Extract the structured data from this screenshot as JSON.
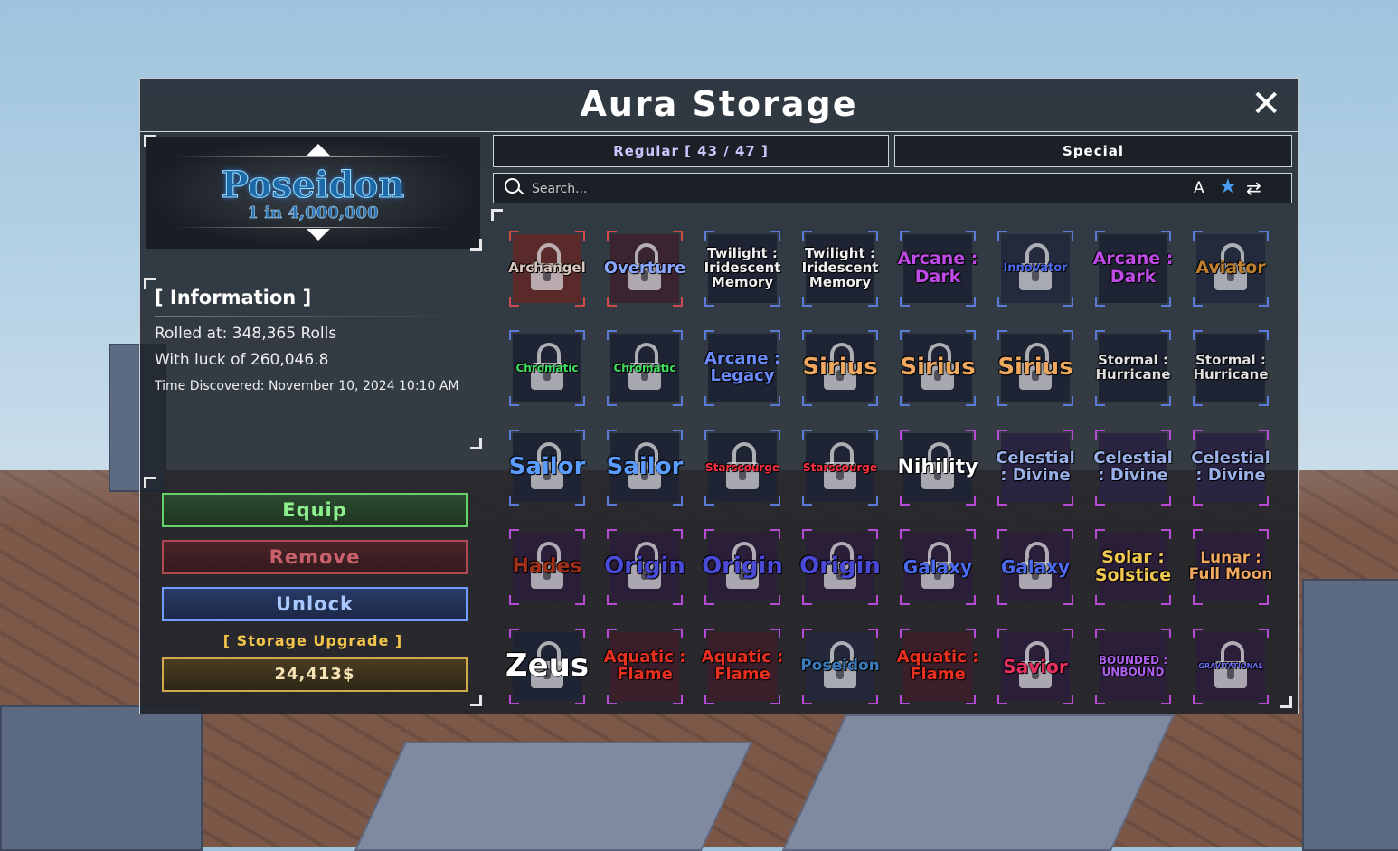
{
  "window": {
    "title": "Aura Storage",
    "close_label": "✕"
  },
  "featured": {
    "name": "Poseidon",
    "rarity": "1 in 4,000,000"
  },
  "information": {
    "header": "[ Information ]",
    "rolled_at": "Rolled at: 348,365 Rolls",
    "luck": "With luck of 260,046.8",
    "time_discovered": "Time Discovered: November 10, 2024 10:10 AM"
  },
  "actions": {
    "equip": "Equip",
    "remove": "Remove",
    "unlock": "Unlock",
    "storage_upgrade": "[ Storage Upgrade ]",
    "price": "24,413$"
  },
  "tabs": {
    "regular": "Regular [ 43 / 47 ]",
    "special": "Special"
  },
  "search": {
    "placeholder": "Search..."
  },
  "toolbar_icons": [
    "sort-alpha-icon",
    "favorite-star-icon",
    "swap-icon"
  ],
  "colors": {
    "purple_frame": "#b84ad8",
    "blue_frame": "#5a7bd8",
    "red_frame": "#d04a4a",
    "star": "#4a9cf0"
  },
  "auras": [
    {
      "name": "Archangel",
      "locked": true,
      "color": "#d8c8c0",
      "size": 15,
      "frame": "#d04a4a",
      "bg": "#5a2a2a"
    },
    {
      "name": "Overture",
      "locked": true,
      "color": "#8aa8ff",
      "size": 18,
      "frame": "#d04a4a",
      "bg": "#3a2430"
    },
    {
      "name": "Twilight : Iridescent Memory",
      "locked": false,
      "color": "#f0f0f0",
      "size": 15,
      "frame": "#5a7bd8",
      "bg": "#1e2433"
    },
    {
      "name": "Twilight : Iridescent Memory",
      "locked": false,
      "color": "#f0f0f0",
      "size": 15,
      "frame": "#5a7bd8",
      "bg": "#1e2433"
    },
    {
      "name": "Arcane : Dark",
      "locked": false,
      "color": "#c04ae8",
      "size": 19,
      "frame": "#5a7bd8",
      "bg": "#1e2433"
    },
    {
      "name": "Innovator",
      "locked": true,
      "color": "#4a6af0",
      "size": 13,
      "frame": "#5a7bd8",
      "bg": "#232a3c"
    },
    {
      "name": "Arcane : Dark",
      "locked": false,
      "color": "#c04ae8",
      "size": 19,
      "frame": "#5a7bd8",
      "bg": "#1e2433"
    },
    {
      "name": "Aviator",
      "locked": true,
      "color": "#c08030",
      "size": 19,
      "frame": "#5a7bd8",
      "bg": "#232a3c"
    },
    {
      "name": "Chromatic",
      "locked": true,
      "color": "#40e060",
      "size": 12,
      "frame": "#5a7bd8",
      "bg": "#1e2433"
    },
    {
      "name": "Chromatic",
      "locked": true,
      "color": "#40e060",
      "size": 12,
      "frame": "#5a7bd8",
      "bg": "#1e2433"
    },
    {
      "name": "Arcane : Legacy",
      "locked": false,
      "color": "#6a8cff",
      "size": 18,
      "frame": "#5a7bd8",
      "bg": "#1e2433"
    },
    {
      "name": "Sirius",
      "locked": true,
      "color": "#f0a860",
      "size": 26,
      "frame": "#5a7bd8",
      "bg": "#1e2433"
    },
    {
      "name": "Sirius",
      "locked": true,
      "color": "#f0a860",
      "size": 26,
      "frame": "#5a7bd8",
      "bg": "#1e2433"
    },
    {
      "name": "Sirius",
      "locked": true,
      "color": "#f0a860",
      "size": 26,
      "frame": "#5a7bd8",
      "bg": "#1e2433"
    },
    {
      "name": "Stormal : Hurricane",
      "locked": false,
      "color": "#e0e0e0",
      "size": 15,
      "frame": "#5a7bd8",
      "bg": "#1e2433"
    },
    {
      "name": "Stormal : Hurricane",
      "locked": false,
      "color": "#e0e0e0",
      "size": 15,
      "frame": "#5a7bd8",
      "bg": "#1e2433"
    },
    {
      "name": "Sailor",
      "locked": true,
      "color": "#5a9cff",
      "size": 26,
      "frame": "#5a7bd8",
      "bg": "#1e2433"
    },
    {
      "name": "Sailor",
      "locked": true,
      "color": "#5a9cff",
      "size": 26,
      "frame": "#5a7bd8",
      "bg": "#1e2433"
    },
    {
      "name": "Starscourge",
      "locked": true,
      "color": "#ff3040",
      "size": 12,
      "frame": "#5a7bd8",
      "bg": "#1e2433"
    },
    {
      "name": "Starscourge",
      "locked": true,
      "color": "#ff3040",
      "size": 12,
      "frame": "#5a7bd8",
      "bg": "#1e2433"
    },
    {
      "name": "Nihility",
      "locked": true,
      "color": "#ffffff",
      "size": 22,
      "frame": "#b84ad8",
      "bg": "#1e2433"
    },
    {
      "name": "Celestial : Divine",
      "locked": false,
      "color": "#9ab0e8",
      "size": 18,
      "frame": "#b84ad8",
      "bg": "#2a2440"
    },
    {
      "name": "Celestial : Divine",
      "locked": false,
      "color": "#9ab0e8",
      "size": 18,
      "frame": "#b84ad8",
      "bg": "#2a2440"
    },
    {
      "name": "Celestial : Divine",
      "locked": false,
      "color": "#9ab0e8",
      "size": 18,
      "frame": "#b84ad8",
      "bg": "#2a2440"
    },
    {
      "name": "Hades",
      "locked": true,
      "color": "#a03018",
      "size": 22,
      "frame": "#b84ad8",
      "bg": "#2a1e38"
    },
    {
      "name": "Origin",
      "locked": true,
      "color": "#4a4ad8",
      "size": 26,
      "frame": "#b84ad8",
      "bg": "#2a1e38"
    },
    {
      "name": "Origin",
      "locked": true,
      "color": "#4a4ad8",
      "size": 26,
      "frame": "#b84ad8",
      "bg": "#2a1e38"
    },
    {
      "name": "Origin",
      "locked": true,
      "color": "#4a4ad8",
      "size": 26,
      "frame": "#b84ad8",
      "bg": "#2a1e38"
    },
    {
      "name": "Galaxy",
      "locked": true,
      "color": "#4a6af0",
      "size": 20,
      "frame": "#b84ad8",
      "bg": "#2a1e38"
    },
    {
      "name": "Galaxy",
      "locked": true,
      "color": "#4a6af0",
      "size": 20,
      "frame": "#b84ad8",
      "bg": "#2a1e38"
    },
    {
      "name": "Solar : Solstice",
      "locked": false,
      "color": "#f0c850",
      "size": 19,
      "frame": "#b84ad8",
      "bg": "#2a1e38"
    },
    {
      "name": "Lunar : Full Moon",
      "locked": false,
      "color": "#f0a860",
      "size": 17,
      "frame": "#b84ad8",
      "bg": "#2a1e38"
    },
    {
      "name": "Zeus",
      "locked": true,
      "color": "#ffffff",
      "size": 34,
      "frame": "#b84ad8",
      "bg": "#1e2433"
    },
    {
      "name": "Aquatic : Flame",
      "locked": false,
      "color": "#e83020",
      "size": 18,
      "frame": "#b84ad8",
      "bg": "#3a1e2a"
    },
    {
      "name": "Aquatic : Flame",
      "locked": false,
      "color": "#e83020",
      "size": 18,
      "frame": "#b84ad8",
      "bg": "#3a1e2a"
    },
    {
      "name": "Poseidon",
      "locked": true,
      "color": "#3a7ab8",
      "size": 17,
      "frame": "#b84ad8",
      "bg": "#24283a"
    },
    {
      "name": "Aquatic : Flame",
      "locked": false,
      "color": "#e83020",
      "size": 18,
      "frame": "#b84ad8",
      "bg": "#3a1e2a"
    },
    {
      "name": "Savior",
      "locked": true,
      "color": "#e83060",
      "size": 20,
      "frame": "#b84ad8",
      "bg": "#2a1e38"
    },
    {
      "name": "BOUNDED : UNBOUND",
      "locked": false,
      "color": "#b060f0",
      "size": 12,
      "frame": "#b84ad8",
      "bg": "#2a1e38"
    },
    {
      "name": "GRAVITATIONAL",
      "locked": true,
      "color": "#6a6af0",
      "size": 8,
      "frame": "#b84ad8",
      "bg": "#2a1e38"
    }
  ]
}
